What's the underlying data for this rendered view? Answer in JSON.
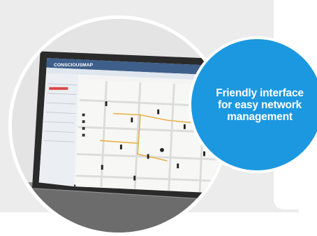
{
  "headline": {
    "line1": "Friendly interface",
    "line2": "for easy network",
    "line3": "management"
  },
  "screen": {
    "app_name": "CONSCIOUSMAP"
  },
  "colors": {
    "accent_blue": "#1b98e0",
    "background_gray": "#ececec"
  },
  "icons": [
    "laptop-screenshot-image"
  ]
}
